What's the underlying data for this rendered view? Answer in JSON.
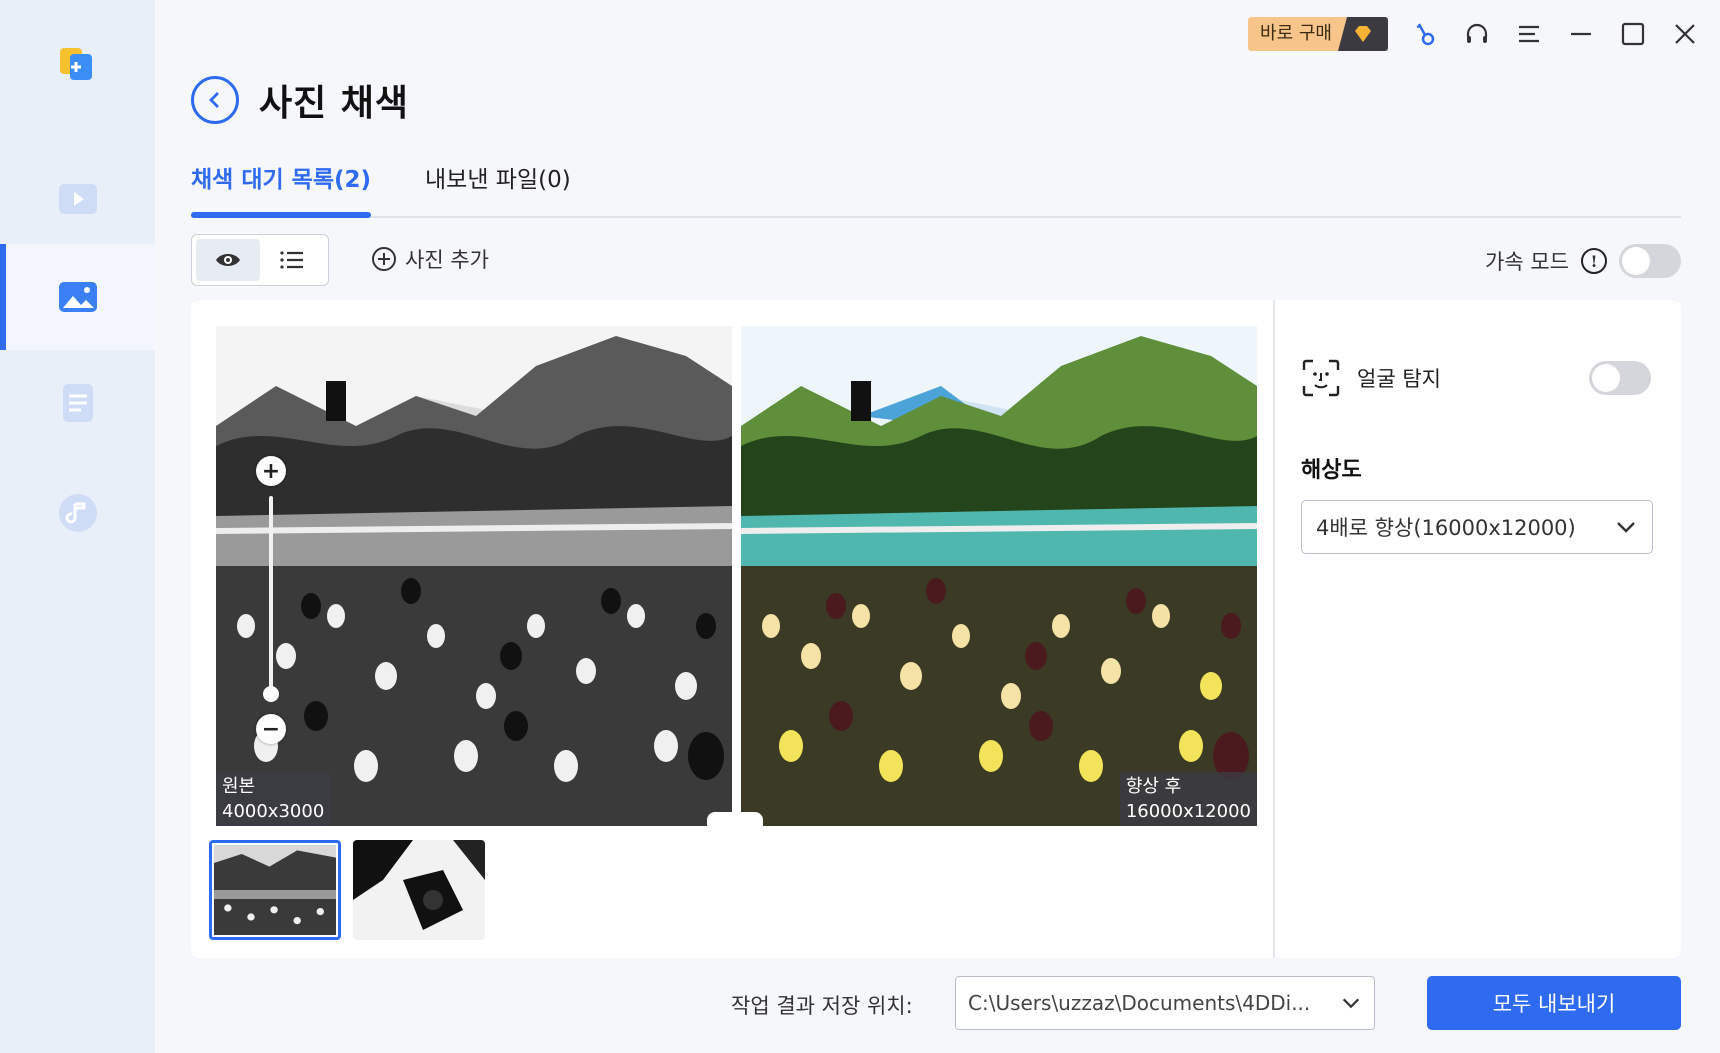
{
  "header": {
    "buy_label": "바로 구매",
    "icons": [
      "key-icon",
      "headset-icon",
      "menu-icon",
      "minimize-icon",
      "maximize-icon",
      "close-icon"
    ]
  },
  "page": {
    "title": "사진 채색"
  },
  "tabs": [
    {
      "label": "채색 대기 목록(2)",
      "active": true
    },
    {
      "label": "내보낸 파일(0)",
      "active": false
    }
  ],
  "toolbar": {
    "add_photo_label": "사진 추가",
    "accel_label": "가속 모드"
  },
  "preview": {
    "left_label_1": "원본",
    "left_label_2": "4000x3000",
    "right_label_1": "향상 후",
    "right_label_2": "16000x12000"
  },
  "settings": {
    "face_label": "얼굴 탐지",
    "res_title": "해상도",
    "res_value": "4배로 향상(16000x12000)"
  },
  "footer": {
    "save_label": "작업 결과 저장 위치:",
    "path_value": "C:\\Users\\uzzaz\\Documents\\4DDi...",
    "export_label": "모두 내보내기"
  },
  "colors": {
    "accent": "#2f6bf0",
    "sidebar_bg": "#e9eff9",
    "buy_bg": "#f7c58a"
  }
}
